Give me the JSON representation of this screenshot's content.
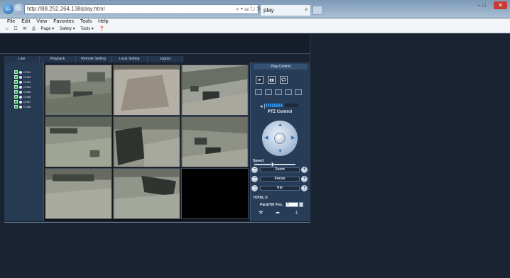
{
  "browser": {
    "address": "http://88.252.264.138/play.html",
    "address_icons": "⌕ ▾ ☲ ↻ ✕",
    "tab_title": "play",
    "menu": [
      "File",
      "Edit",
      "View",
      "Favorites",
      "Tools",
      "Help"
    ],
    "toolbar": [
      "Page ▾",
      "Safety ▾",
      "Tools ▾"
    ],
    "win_close": "✕",
    "win_min": "− □"
  },
  "nav": {
    "items": [
      "Live",
      "Playback",
      "Remote Setting",
      "Local Setting",
      "Logout"
    ]
  },
  "channels": [
    "CH01",
    "CH02",
    "CH03",
    "CH04",
    "CH05",
    "CH06",
    "CH07",
    "CH08"
  ],
  "ptz": {
    "play_control_title": "Play Control",
    "ptz_control_title": "PTZ Control",
    "volume_level": 0.55,
    "speed_label": "Speed",
    "speed_value": 0.45,
    "zoom_label": "Zoom",
    "focus_label": "Focus",
    "iris_label": "Iris",
    "minus_symbol": "−",
    "plus_symbol": "+",
    "total_label": "TOTAL:0",
    "pantilt_label": "Pan&Tilt Pos.",
    "pantilt_value": "1"
  },
  "icons": {
    "volume": "◂❘",
    "tools": [
      "⚒",
      "➡",
      "⤓"
    ],
    "arrows": [
      "▲",
      "▼",
      "◀",
      "▶"
    ]
  },
  "colors": {
    "page_bg": "#1a2332",
    "panel_bg": "#273c57",
    "nav_bg": "#23344c",
    "channel_checked": "#1fbf3c",
    "volume_fill": "#2f8fe6"
  }
}
